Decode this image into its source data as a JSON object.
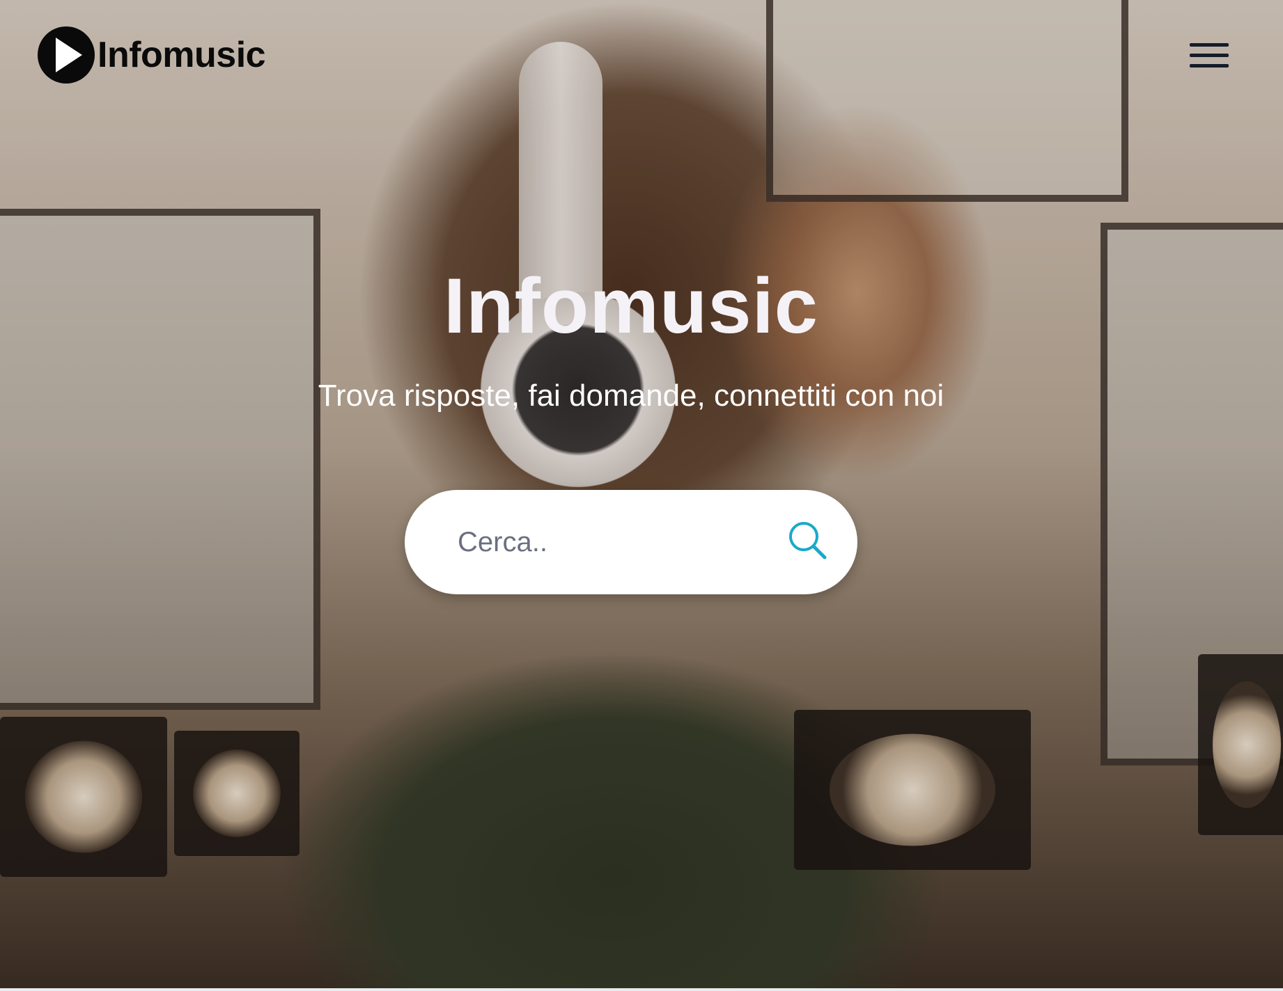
{
  "header": {
    "logo_text": "Infomusic",
    "logo_icon": "play-circle-icon",
    "menu_icon": "hamburger-menu-icon"
  },
  "hero": {
    "title": "Infomusic",
    "subtitle": "Trova risposte, fai domande, connettiti con noi",
    "background_image": "man with curly hair wearing white headphones in a recording studio"
  },
  "search": {
    "placeholder": "Cerca..",
    "value": "",
    "icon": "search-icon",
    "icon_color": "#1aa9c9"
  },
  "colors": {
    "title_text": "#f5f2f7",
    "logo": "#0a0a0a",
    "menu": "#141c2a",
    "search_bg": "#ffffff"
  }
}
